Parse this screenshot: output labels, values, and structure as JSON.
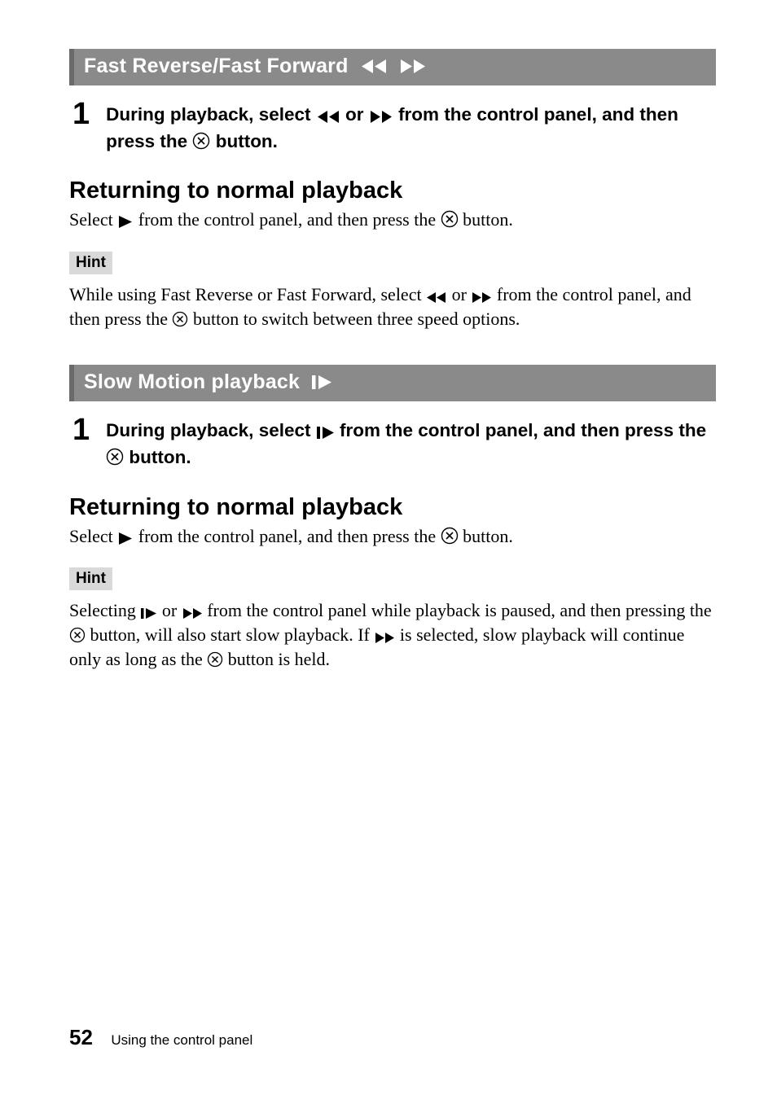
{
  "section1": {
    "title": "Fast Reverse/Fast Forward",
    "step_num": "1",
    "step_part1": "During playback, select",
    "step_part2": "or",
    "step_part3": "from the control panel, and then press the",
    "step_part4": "button.",
    "return_heading": "Returning to normal playback",
    "return_body1": "Select",
    "return_body2": "from the control panel, and then press the",
    "return_body3": "button.",
    "hint_label": "Hint",
    "hint_part1": "While using Fast Reverse or Fast Forward, select",
    "hint_part2": "or",
    "hint_part3": "from the control panel, and then press the",
    "hint_part4": "button to switch between three speed options."
  },
  "section2": {
    "title": "Slow Motion playback",
    "step_num": "1",
    "step_part1": "During playback, select",
    "step_part2": "from the control panel, and then press the",
    "step_part3": "button.",
    "return_heading": "Returning to normal playback",
    "return_body1": "Select",
    "return_body2": "from the control panel, and then press the",
    "return_body3": "button.",
    "hint_label": "Hint",
    "hint_part1": "Selecting",
    "hint_part2": "or",
    "hint_part3": "from the control panel while playback is paused, and then pressing the",
    "hint_part4": "button, will also start slow playback. If",
    "hint_part5": "is selected, slow playback will continue only as long as the",
    "hint_part6": "button is held."
  },
  "footer": {
    "page": "52",
    "caption": "Using the control panel"
  }
}
